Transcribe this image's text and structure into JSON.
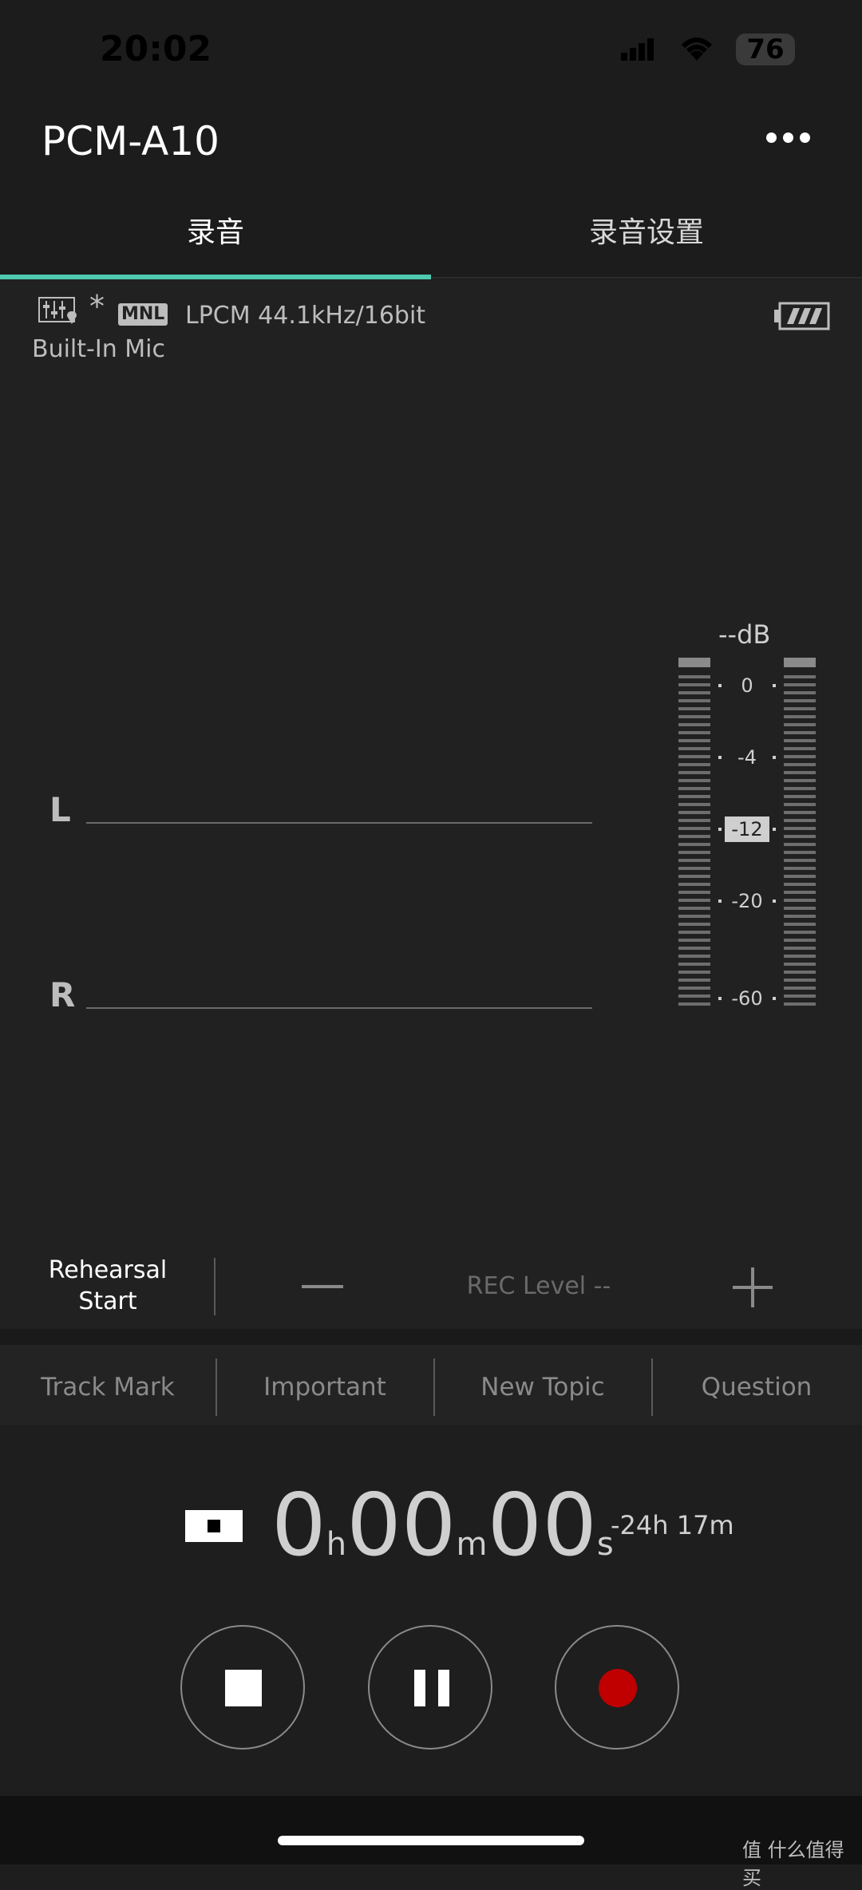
{
  "status_bar": {
    "time": "20:02",
    "battery": "76"
  },
  "header": {
    "title": "PCM-A10"
  },
  "tabs": [
    {
      "label": "录音"
    },
    {
      "label": "录音设置"
    }
  ],
  "recorder": {
    "asterisk": "*",
    "mode_badge": "MNL",
    "format": "LPCM 44.1kHz/16bit",
    "input": "Built-In Mic"
  },
  "waveform": {
    "left_label": "L",
    "right_label": "R"
  },
  "level_meter": {
    "db_readout": "--dB",
    "ticks": [
      "0",
      "-4",
      "-12",
      "-20",
      "-60"
    ],
    "left_level": 0,
    "right_level": 0
  },
  "rec_level": {
    "rehearsal_line1": "Rehearsal",
    "rehearsal_line2": "Start",
    "label": "REC Level --"
  },
  "marks": [
    "Track Mark",
    "Important",
    "New Topic",
    "Question"
  ],
  "counter": {
    "hours": "0",
    "hours_unit": "h",
    "minutes": "00",
    "minutes_unit": "m",
    "seconds": "00",
    "seconds_unit": "s",
    "remaining": "-24h 17m"
  },
  "watermark": "值 什么值得买",
  "colors": {
    "accent": "#4fc9b0",
    "record": "#c00000",
    "background": "#1e1e1e"
  },
  "icons": [
    "signal-icon",
    "wifi-icon",
    "more-icon",
    "scene-icon",
    "battery-icon",
    "stop-icon",
    "pause-icon",
    "record-icon"
  ]
}
